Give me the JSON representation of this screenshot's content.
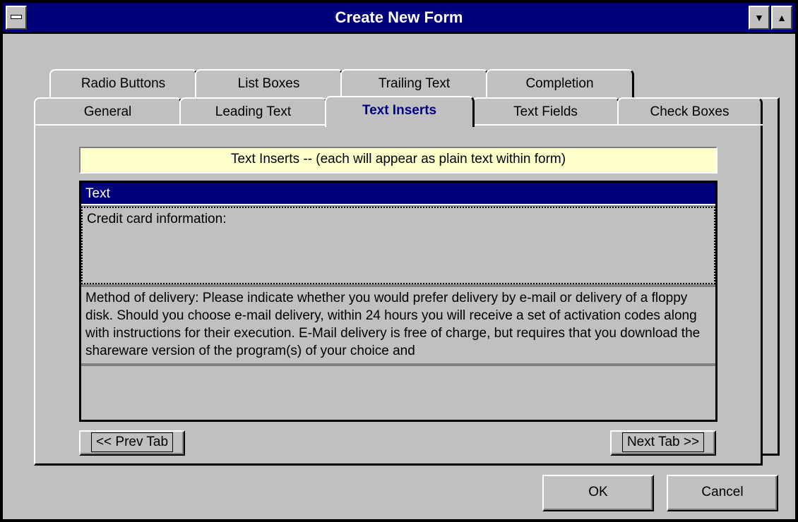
{
  "window": {
    "title": "Create New Form"
  },
  "tabs_back": [
    "Radio Buttons",
    "List Boxes",
    "Trailing Text",
    "Completion"
  ],
  "tabs_front": [
    "General",
    "Leading Text",
    "Text Inserts",
    "Text Fields",
    "Check Boxes"
  ],
  "active_tab": "Text Inserts",
  "panel": {
    "heading": "Text Inserts -- (each will appear as plain text within form)",
    "grid": {
      "column": "Text",
      "rows": [
        "Credit card information:",
        "Method of delivery:  Please indicate whether you would prefer delivery by e-mail or delivery of a floppy disk.  Should you choose e-mail delivery, within 24 hours you will receive a set of activation codes along with instructions for their execution.  E-Mail delivery is free of charge, but requires that you download the shareware version of the program(s) of your choice and",
        ""
      ]
    },
    "prev_label": "<< Prev Tab",
    "next_label": "Next Tab >>"
  },
  "buttons": {
    "ok": "OK",
    "cancel": "Cancel"
  }
}
